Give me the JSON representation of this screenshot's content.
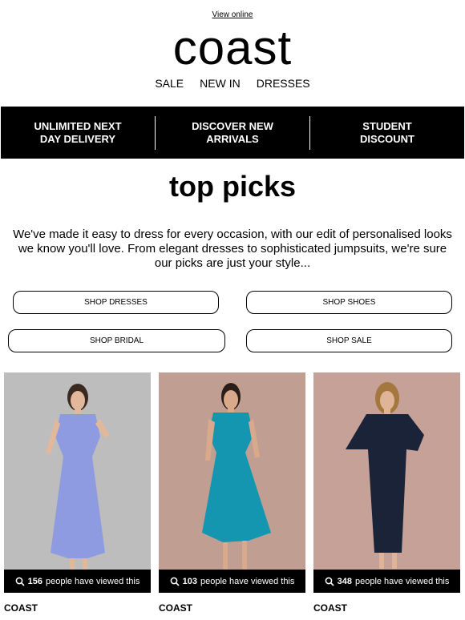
{
  "header": {
    "view_online": "View online",
    "logo": "coast",
    "nav": [
      "SALE",
      "NEW IN",
      "DRESSES"
    ]
  },
  "banner": {
    "items": [
      "UNLIMITED NEXT\nDAY DELIVERY",
      "DISCOVER NEW\nARRIVALS",
      "STUDENT\nDISCOUNT"
    ]
  },
  "main": {
    "title": "top picks",
    "intro": "We've made it easy to dress for every occasion, with our edit of personalised looks we know you'll love. From elegant dresses to sophisticated jumpsuits, we're sure our picks are just your style...",
    "buttons": [
      "SHOP DRESSES",
      "SHOP SHOES",
      "SHOP BRIDAL",
      "SHOP SALE"
    ]
  },
  "products": [
    {
      "views": "156",
      "views_text": "people have viewed this",
      "brand": "COAST",
      "dress_color": "#8f9be0",
      "bg_color": "#bdbdbd",
      "search_icon": "search-icon"
    },
    {
      "views": "103",
      "views_text": "people have viewed this",
      "brand": "COAST",
      "dress_color": "#1596b0",
      "bg_color": "#c19e92",
      "search_icon": "search-icon"
    },
    {
      "views": "348",
      "views_text": "people have viewed this",
      "brand": "COAST",
      "dress_color": "#1b2339",
      "bg_color": "#c5a197",
      "search_icon": "search-icon"
    }
  ]
}
